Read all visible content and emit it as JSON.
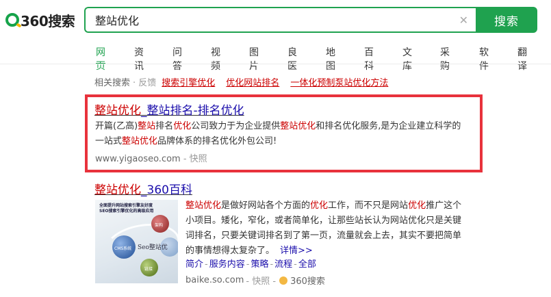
{
  "header": {
    "logo_text": "360搜索",
    "search_value": "整站优化",
    "clear_glyph": "✕",
    "search_button": "搜索"
  },
  "nav": {
    "items": [
      "网页",
      "资讯",
      "问答",
      "视频",
      "图片",
      "良医",
      "地图",
      "百科",
      "文库",
      "采购",
      "软件",
      "翻译"
    ],
    "active": "网页"
  },
  "related": {
    "label": "相关搜索",
    "feedback": "· 反馈",
    "links": [
      "搜索引擎优化",
      "优化网站排名",
      "一体化预制泵站优化方法"
    ]
  },
  "result1": {
    "title_hl": "整站优化",
    "title_rest": "_整站排名-排名优化",
    "snippet_parts": [
      {
        "t": "开篇(乙高)",
        "hl": false
      },
      {
        "t": "整站",
        "hl": true
      },
      {
        "t": "排名",
        "hl": false
      },
      {
        "t": "优化",
        "hl": true
      },
      {
        "t": "公司致力于为企业提供",
        "hl": false
      },
      {
        "t": "整站优化",
        "hl": true
      },
      {
        "t": "和排名优化服务,是为企业建立科学的",
        "hl": false
      }
    ],
    "snippet_line2_parts": [
      {
        "t": "一站式",
        "hl": false
      },
      {
        "t": "整站优化",
        "hl": true
      },
      {
        "t": "品牌体系的排名优化外包公司!",
        "hl": false
      }
    ],
    "url": "www.yigaoseo.com",
    "snapshot": "- 快照"
  },
  "result2": {
    "title_hl": "整站优化",
    "title_rest": "_360百科",
    "thumb_text_top": "全面提升网站搜索引擎友好度\nSEO搜索引擎优化的高级应用",
    "thumb_labels": [
      "架构",
      "CMS系统",
      "Seo整站优",
      "链接"
    ],
    "snippet_lines": [
      [
        {
          "t": "整站优化",
          "hl": true
        },
        {
          "t": "是做好网站各个方面的",
          "hl": false
        },
        {
          "t": "优化",
          "hl": true
        },
        {
          "t": "工作，而不只是网站",
          "hl": false
        },
        {
          "t": "优化",
          "hl": true
        },
        {
          "t": "推广这个",
          "hl": false
        }
      ],
      [
        {
          "t": "小项目。矮化，窄化，或者简单化，让那些站长认为网站优化只是关键",
          "hl": false
        }
      ],
      [
        {
          "t": "词排名，只要关键词排名到了第一页，流量就会上去，其实不要把简单",
          "hl": false
        }
      ],
      [
        {
          "t": "的事情想得太复杂了。",
          "hl": false
        }
      ]
    ],
    "detail_link": "详情>>",
    "sub_links": [
      "简介",
      "服务内容",
      "策略",
      "流程",
      "全部"
    ],
    "url": "baike.so.com",
    "snapshot": "- 快照 -",
    "source": "360搜索"
  }
}
